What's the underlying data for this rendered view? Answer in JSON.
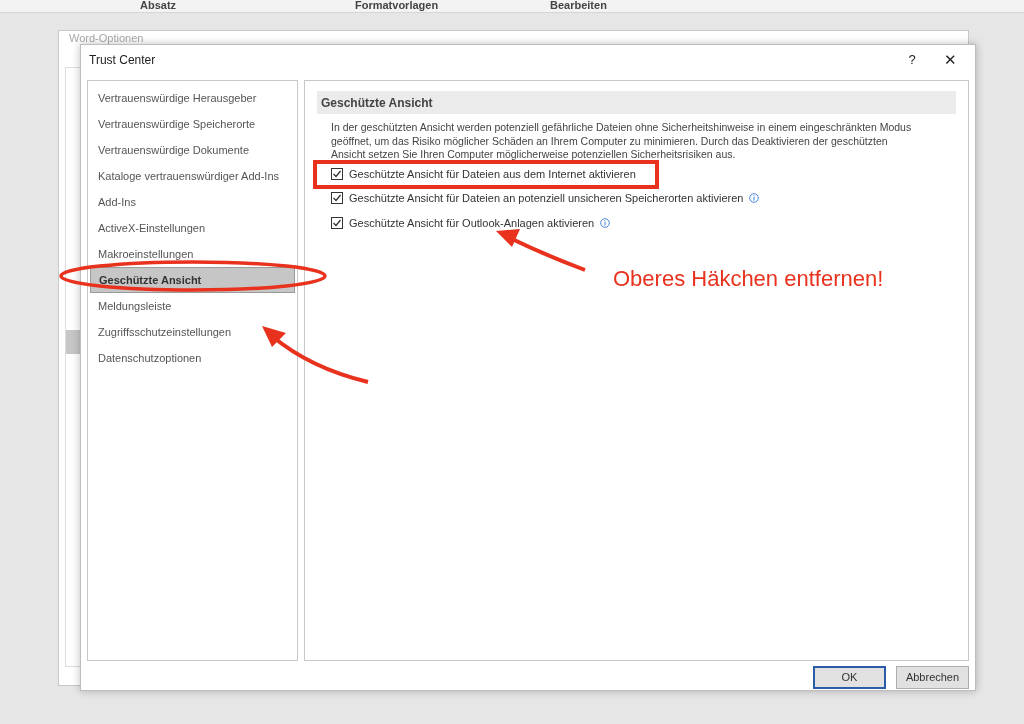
{
  "ribbon": {
    "groups": [
      "Absatz",
      "Formatvorlagen",
      "Bearbeiten"
    ]
  },
  "background_window": {
    "title": "Word-Optionen"
  },
  "dialog": {
    "title": "Trust Center",
    "help": "?",
    "close": "✕"
  },
  "sidebar": {
    "items": [
      {
        "label": "Vertrauenswürdige Herausgeber",
        "selected": false
      },
      {
        "label": "Vertrauenswürdige Speicherorte",
        "selected": false
      },
      {
        "label": "Vertrauenswürdige Dokumente",
        "selected": false
      },
      {
        "label": "Kataloge vertrauenswürdiger Add-Ins",
        "selected": false
      },
      {
        "label": "Add-Ins",
        "selected": false
      },
      {
        "label": "ActiveX-Einstellungen",
        "selected": false
      },
      {
        "label": "Makroeinstellungen",
        "selected": false
      },
      {
        "label": "Geschützte Ansicht",
        "selected": true
      },
      {
        "label": "Meldungsleiste",
        "selected": false
      },
      {
        "label": "Zugriffsschutzeinstellungen",
        "selected": false
      },
      {
        "label": "Datenschutzoptionen",
        "selected": false
      }
    ]
  },
  "section": {
    "heading": "Geschützte Ansicht",
    "description": "In der geschützten Ansicht werden potenziell gefährliche Dateien ohne Sicherheitshinweise in einem eingeschränkten Modus geöffnet, um das Risiko möglicher Schäden an Ihrem Computer zu minimieren. Durch das Deaktivieren der geschützten Ansicht setzen Sie Ihren Computer möglicherweise potenziellen Sicherheitsrisiken aus.",
    "options": [
      {
        "label": "Geschützte Ansicht für Dateien aus dem Internet aktivieren",
        "checked": true,
        "info": false
      },
      {
        "label": "Geschützte Ansicht für Dateien an potenziell unsicheren Speicherorten aktivieren",
        "checked": true,
        "info": true
      },
      {
        "label": "Geschützte Ansicht für Outlook-Anlagen aktivieren",
        "checked": true,
        "info": true
      }
    ]
  },
  "buttons": [
    {
      "label": "OK",
      "default": true
    },
    {
      "label": "Abbrechen",
      "default": false
    }
  ],
  "annotation": {
    "text": "Oberes Häkchen entfernen!"
  }
}
